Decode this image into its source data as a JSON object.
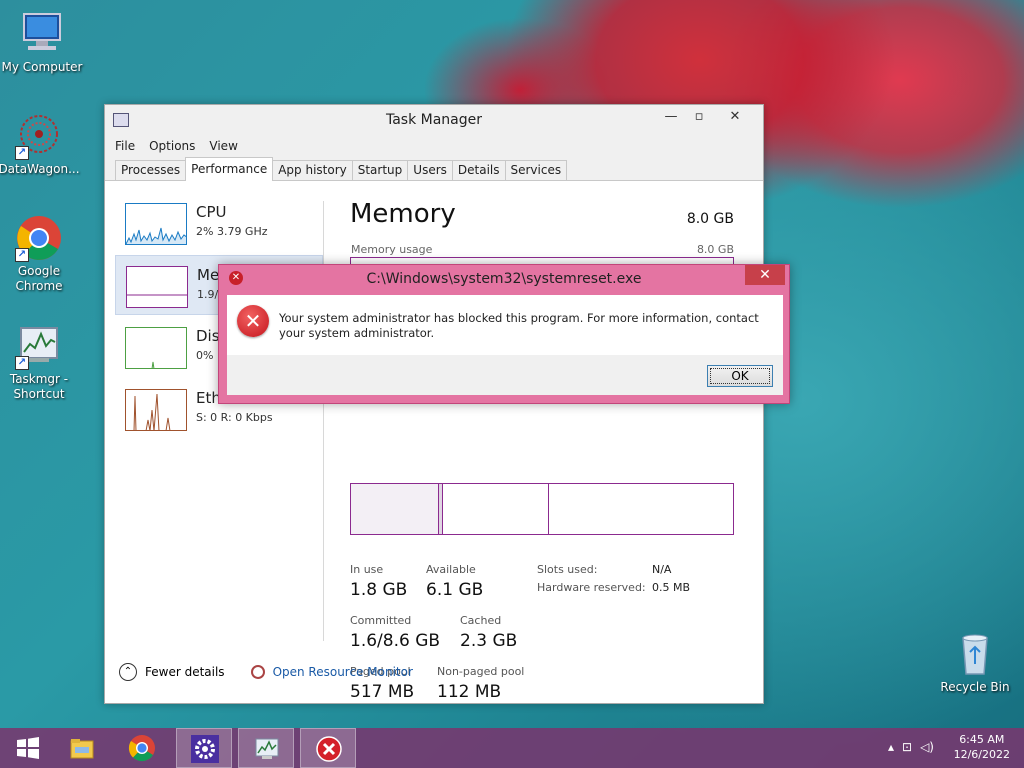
{
  "desktop": {
    "icons": [
      {
        "label": "My Computer"
      },
      {
        "label": "DataWagon..."
      },
      {
        "label": "Google Chrome"
      },
      {
        "label": "Taskmgr - Shortcut"
      },
      {
        "label": "Recycle Bin"
      }
    ]
  },
  "task_manager": {
    "title": "Task Manager",
    "menu": [
      "File",
      "Options",
      "View"
    ],
    "tabs": [
      "Processes",
      "Performance",
      "App history",
      "Startup",
      "Users",
      "Details",
      "Services"
    ],
    "active_tab": "Performance",
    "sidebar": [
      {
        "name": "CPU",
        "sub": "2% 3.79 GHz",
        "color": "#1a7bc4"
      },
      {
        "name": "Me",
        "sub": "1.9/",
        "color": "#8b2a8f"
      },
      {
        "name": "Dis",
        "sub": "0%",
        "color": "#4da043"
      },
      {
        "name": "Eth",
        "sub": "S: 0 R: 0 Kbps",
        "color": "#a0522d"
      }
    ],
    "memory": {
      "title": "Memory",
      "total": "8.0 GB",
      "usage_label": "Memory usage",
      "usage_max": "8.0 GB",
      "in_use_label": "In use",
      "in_use": "1.8 GB",
      "available_label": "Available",
      "available": "6.1 GB",
      "committed_label": "Committed",
      "committed": "1.6/8.6 GB",
      "cached_label": "Cached",
      "cached": "2.3 GB",
      "paged_label": "Paged pool",
      "paged": "517 MB",
      "nonpaged_label": "Non-paged pool",
      "nonpaged": "112 MB",
      "slots_label": "Slots used:",
      "slots": "N/A",
      "hw_label": "Hardware reserved:",
      "hw": "0.5 MB"
    },
    "footer": {
      "fewer_details": "Fewer details",
      "resource_monitor": "Open Resource Monitor"
    }
  },
  "error_dialog": {
    "title": "C:\\Windows\\system32\\systemreset.exe",
    "message": "Your system administrator has blocked this program. For more information, contact your system administrator.",
    "ok_label": "OK",
    "close_glyph": "✕"
  },
  "taskbar": {
    "time": "6:45 AM",
    "date": "12/6/2022"
  }
}
